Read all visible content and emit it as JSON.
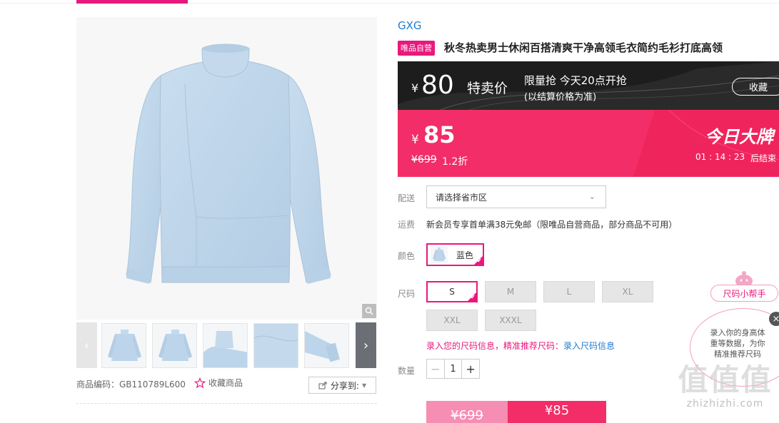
{
  "gallery": {
    "item_code_label": "商品编码：GB110789L600",
    "favorite_label": "收藏商品",
    "share_label": "分享到:",
    "thumb_count": 5
  },
  "product": {
    "brand": "GXG",
    "badge": "唯品自营",
    "title": "秋冬热卖男士休闲百搭清爽干净高领毛衣简约毛衫打底高领"
  },
  "flash_sale": {
    "currency": "¥",
    "price": "80",
    "label": "特卖价",
    "limit_line1": "限量抢 今天20点开抢",
    "limit_line2": "(以结算价格为准)",
    "collect_button": "收藏"
  },
  "sale_banner": {
    "currency": "¥",
    "price": "85",
    "original_price": "¥699",
    "discount": "1.2折",
    "campaign": "今日大牌",
    "countdown": "01 : 14 : 23",
    "ends_label": "后结束",
    "background_color": "#f22d67"
  },
  "shipping": {
    "label": "配送",
    "placeholder": "请选择省市区"
  },
  "freight": {
    "label": "运费",
    "text": "新会员专享首单满38元免邮（限唯品自营商品，部分商品不可用）"
  },
  "color": {
    "label": "颜色",
    "options": [
      {
        "name": "蓝色",
        "selected": true
      }
    ]
  },
  "size": {
    "label": "尺码",
    "options": [
      {
        "name": "S",
        "selected": true
      },
      {
        "name": "M",
        "selected": false
      },
      {
        "name": "L",
        "selected": false
      },
      {
        "name": "XL",
        "selected": false
      },
      {
        "name": "XXL",
        "selected": false
      },
      {
        "name": "XXXL",
        "selected": false
      }
    ],
    "tip_text": "录入您的尺码信息，精准推荐尺码：",
    "tip_link": "录入尺码信息"
  },
  "quantity": {
    "label": "数量",
    "value": "1",
    "minus": "−",
    "plus": "+"
  },
  "buy_bar": {
    "original_price": "¥699",
    "sale_price": "¥85"
  },
  "size_helper": {
    "title": "尺码小帮手",
    "text": "录入你的身高体重等数据，为你精准推荐尺码",
    "close": "×"
  },
  "watermark": {
    "logo": "值值值",
    "text": "zhizhizhi.com"
  },
  "colors": {
    "accent": "#e8197d",
    "link": "#1f7bd1",
    "sweater": "#bcd5ea"
  }
}
